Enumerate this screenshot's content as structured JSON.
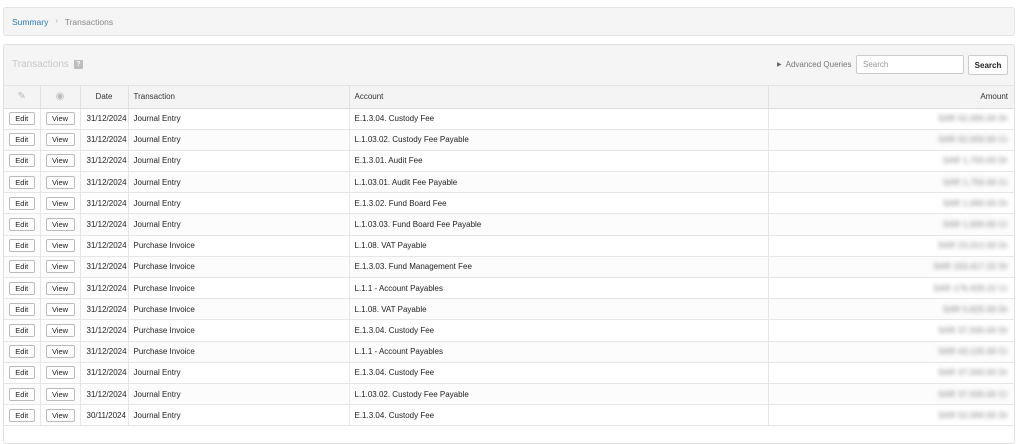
{
  "breadcrumb": {
    "summary": "Summary",
    "separator": "›",
    "current": "Transactions"
  },
  "panel": {
    "title": "Transactions",
    "help_icon": "?",
    "advanced_queries": "Advanced Queries",
    "search_placeholder": "Search",
    "search_button": "Search"
  },
  "table": {
    "headers": {
      "edit_icon": "edit-icon",
      "view_icon": "eye-icon",
      "date": "Date",
      "transaction": "Transaction",
      "account": "Account",
      "amount": "Amount"
    },
    "edit_label": "Edit",
    "view_label": "View",
    "rows": [
      {
        "date": "31/12/2024",
        "transaction": "Journal Entry",
        "account": "E.1.3.04. Custody Fee",
        "amount": "SAR 52,000.00 Dr"
      },
      {
        "date": "31/12/2024",
        "transaction": "Journal Entry",
        "account": "L.1.03.02. Custody Fee Payable",
        "amount": "SAR 52,000.00 Cr"
      },
      {
        "date": "31/12/2024",
        "transaction": "Journal Entry",
        "account": "E.1.3.01. Audit Fee",
        "amount": "SAR 1,750.00 Dr"
      },
      {
        "date": "31/12/2024",
        "transaction": "Journal Entry",
        "account": "L.1.03.01. Audit Fee Payable",
        "amount": "SAR 1,750.00 Cr"
      },
      {
        "date": "31/12/2024",
        "transaction": "Journal Entry",
        "account": "E.1.3.02. Fund Board Fee",
        "amount": "SAR 1,000.00 Dr"
      },
      {
        "date": "31/12/2024",
        "transaction": "Journal Entry",
        "account": "L.1.03.03. Fund Board Fee Payable",
        "amount": "SAR 1,000.00 Cr"
      },
      {
        "date": "31/12/2024",
        "transaction": "Purchase Invoice",
        "account": "L.1.08. VAT Payable",
        "amount": "SAR 23,012.00 Dr"
      },
      {
        "date": "31/12/2024",
        "transaction": "Purchase Invoice",
        "account": "E.1.3.03. Fund Management Fee",
        "amount": "SAR 153,417.22 Dr"
      },
      {
        "date": "31/12/2024",
        "transaction": "Purchase Invoice",
        "account": "L.1.1 - Account Payables",
        "amount": "SAR 176,429.22 Cr"
      },
      {
        "date": "31/12/2024",
        "transaction": "Purchase Invoice",
        "account": "L.1.08. VAT Payable",
        "amount": "SAR 5,625.00 Dr"
      },
      {
        "date": "31/12/2024",
        "transaction": "Purchase Invoice",
        "account": "E.1.3.04. Custody Fee",
        "amount": "SAR 37,500.00 Dr"
      },
      {
        "date": "31/12/2024",
        "transaction": "Purchase Invoice",
        "account": "L.1.1 - Account Payables",
        "amount": "SAR 43,125.00 Cr"
      },
      {
        "date": "31/12/2024",
        "transaction": "Journal Entry",
        "account": "E.1.3.04. Custody Fee",
        "amount": "SAR 37,500.00 Dr"
      },
      {
        "date": "31/12/2024",
        "transaction": "Journal Entry",
        "account": "L.1.03.02. Custody Fee Payable",
        "amount": "SAR 37,500.00 Cr"
      },
      {
        "date": "30/11/2024",
        "transaction": "Journal Entry",
        "account": "E.1.3.04. Custody Fee",
        "amount": "SAR 52,000.00 Dr"
      }
    ]
  }
}
